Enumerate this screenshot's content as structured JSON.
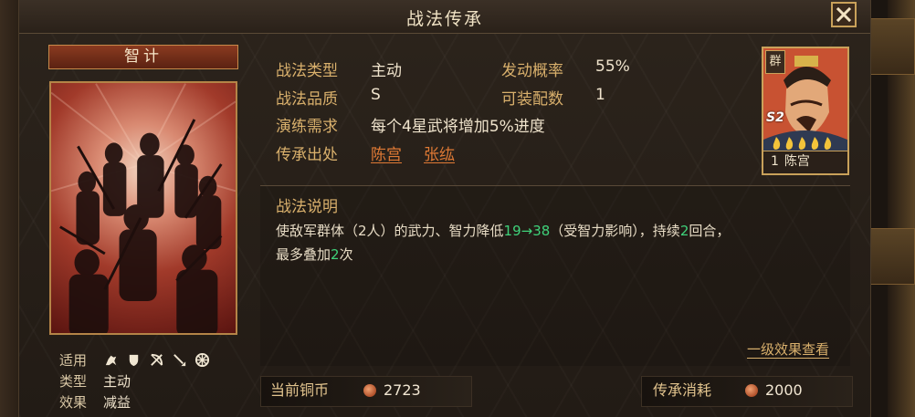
{
  "window": {
    "title": "战法传承",
    "close_icon": "close-icon"
  },
  "skill": {
    "category": "智计",
    "properties": {
      "target_label": "适用",
      "target_icons": [
        "cavalry-icon",
        "shield-icon",
        "bow-icon",
        "spear-icon",
        "wheel-icon"
      ],
      "type_label": "类型",
      "type_value": "主动",
      "effect_label": "效果",
      "effect_value": "减益"
    }
  },
  "info": {
    "type_label": "战法类型",
    "type_value": "主动",
    "trigger_label": "发动概率",
    "trigger_value": "55%",
    "quality_label": "战法品质",
    "quality_value": "S",
    "equip_label": "可装配数",
    "equip_value": "1",
    "train_label": "演练需求",
    "train_value": "每个4星武将增加5%进度",
    "source_label": "传承出处",
    "source_heroes": [
      "陈宫",
      "张纮"
    ]
  },
  "hero_card": {
    "faction": "群",
    "season": "S2",
    "stars": 5,
    "level": "1",
    "name": "陈宫"
  },
  "description": {
    "title": "战法说明",
    "text_1": "使敌军群体（2人）的武力、智力降低",
    "range": "19→38",
    "text_2": "（受智力影响），持续",
    "duration": "2",
    "text_3": "回合，",
    "text_4": "最多叠加",
    "stacks": "2",
    "text_5": "次",
    "detail_link": "一级效果查看"
  },
  "footer": {
    "coins_label": "当前铜币",
    "coins_value": "2723",
    "cost_label": "传承消耗",
    "cost_value": "2000"
  },
  "colors": {
    "label_gold": "#d9b06c",
    "link_orange": "#e07a35",
    "highlight_green": "#3fd27a",
    "frame_gold": "#c9a15a"
  }
}
